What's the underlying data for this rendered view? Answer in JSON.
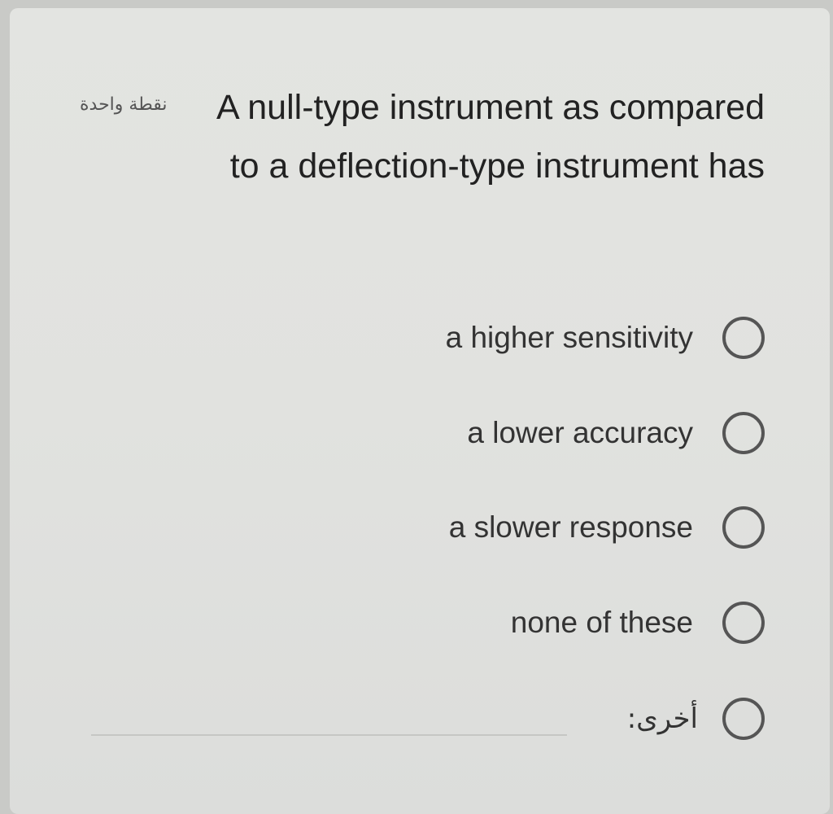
{
  "question": {
    "points_label": "نقطة واحدة",
    "title": "A null-type instrument as compared to a deflection-type instrument has"
  },
  "options": [
    {
      "label": "a higher sensitivity"
    },
    {
      "label": "a lower accuracy"
    },
    {
      "label": "a slower response"
    },
    {
      "label": "none of these"
    }
  ],
  "other": {
    "label": "أخرى:",
    "value": ""
  }
}
